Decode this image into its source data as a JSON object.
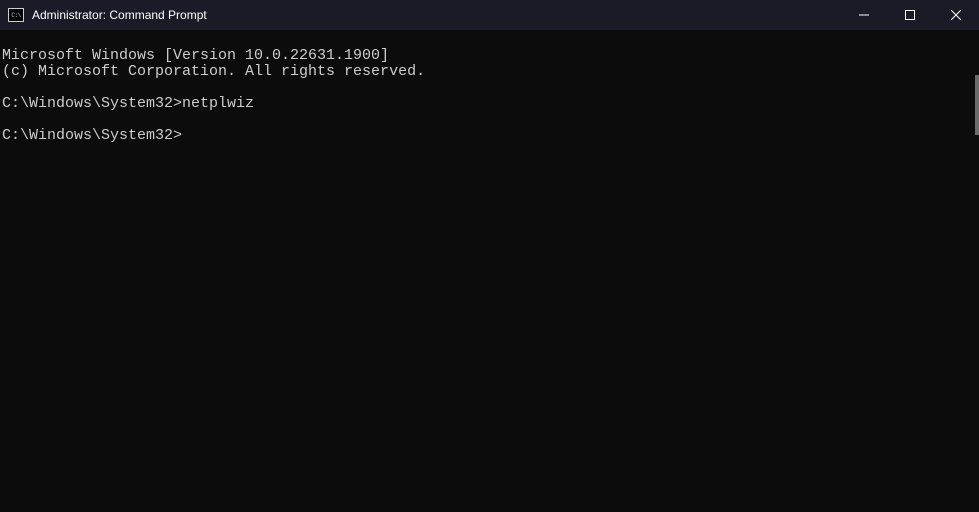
{
  "titlebar": {
    "icon_label": "C:\\",
    "title": "Administrator: Command Prompt"
  },
  "terminal": {
    "line1": "Microsoft Windows [Version 10.0.22631.1900]",
    "line2": "(c) Microsoft Corporation. All rights reserved.",
    "line3": "",
    "prompt1": "C:\\Windows\\System32>",
    "command1": "netplwiz",
    "line5": "",
    "prompt2": "C:\\Windows\\System32>"
  }
}
